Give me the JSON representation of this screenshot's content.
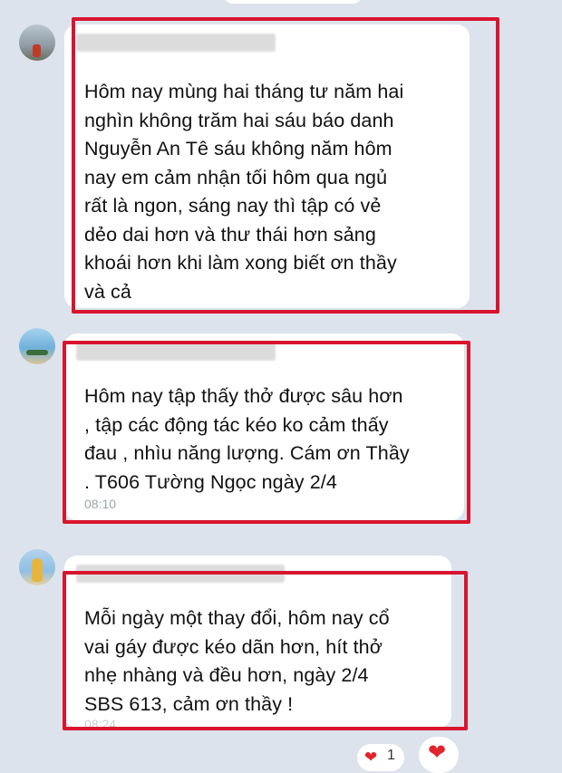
{
  "messages": [
    {
      "lines": [
        "Hôm nay mùng hai tháng tư năm hai",
        "nghìn không trăm hai sáu báo danh",
        "Nguyễn An Tê sáu không năm hôm",
        "nay em cảm nhận tối hôm qua ngủ",
        "rất là ngon, sáng nay thì tập có vẻ",
        "dẻo dai hơn và thư thái hơn sảng",
        "khoái hơn khi làm xong biết ơn thầy",
        "và cả"
      ],
      "time": ""
    },
    {
      "lines": [
        "Hôm nay tập thấy thở được sâu hơn",
        ", tập các động tác kéo ko cảm thấy",
        "đau , nhìu năng lượng. Cám ơn Thầy",
        ". T606 Tường Ngọc ngày 2/4"
      ],
      "time": "08:10"
    },
    {
      "lines": [
        "Mỗi ngày một thay đổi, hôm nay cổ",
        "vai gáy được kéo dãn hơn, hít thở",
        "nhẹ nhàng và đều hơn, ngày 2/4",
        "SBS 613, cảm ơn thầy !"
      ],
      "time": "08:24"
    }
  ],
  "reactions": {
    "icon": "heart-icon",
    "count": "1",
    "color": "#e0252f"
  },
  "colors": {
    "background": "#dde3ec",
    "bubble": "#ffffff",
    "highlight": "#d8152f"
  }
}
